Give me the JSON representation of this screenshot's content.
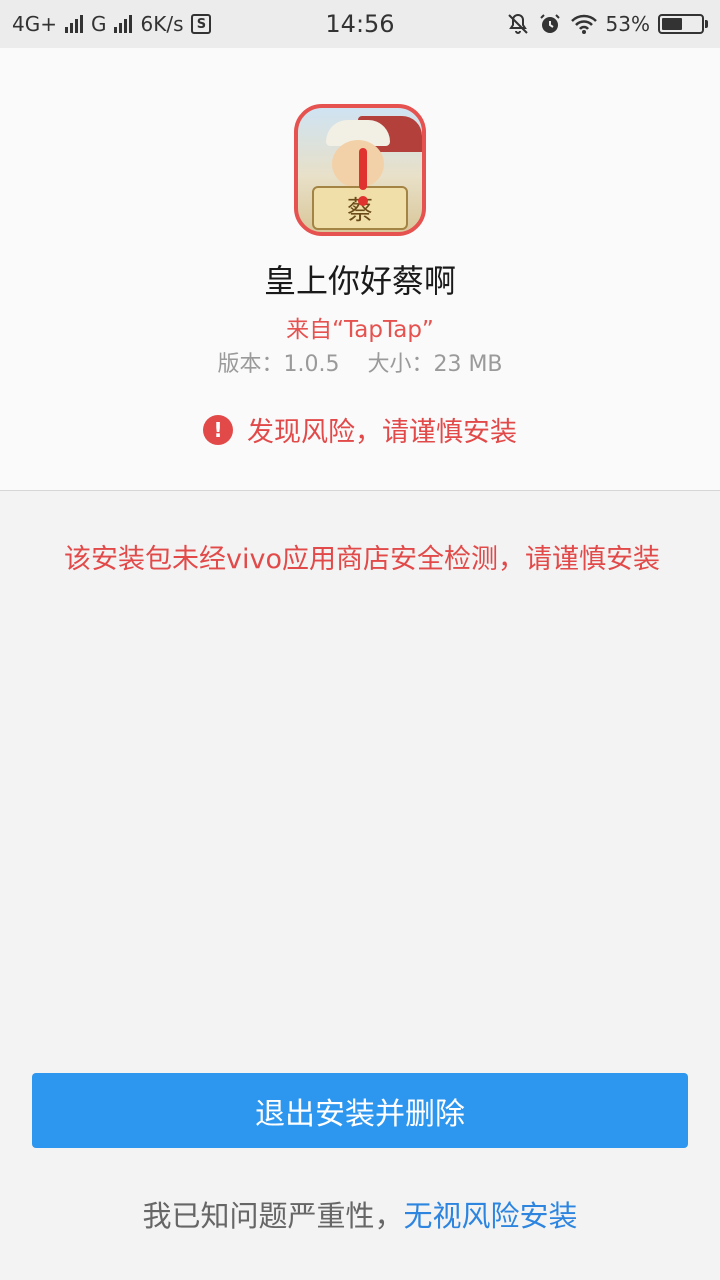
{
  "status_bar": {
    "network1": "4G+",
    "network2": "G",
    "speed": "6K/s",
    "s_badge": "S",
    "time": "14:56",
    "battery": "53%",
    "battery_level": 0.53,
    "icons": [
      "signal-icon",
      "signal-icon",
      "notification-muted-icon",
      "alarm-icon",
      "wifi-icon",
      "battery-icon"
    ]
  },
  "app": {
    "icon_char": "蔡",
    "name": "皇上你好蔡啊",
    "source": "来自“TapTap”",
    "version": "版本：1.0.5",
    "size": "大小：23 MB"
  },
  "risk": {
    "icon": "!",
    "text": "发现风险，请谨慎安装"
  },
  "warning": "该安装包未经vivo应用商店安全检测，请谨慎安装",
  "actions": {
    "exit_button": "退出安装并删除",
    "acknowledge_prefix": "我已知问题严重性，",
    "ignore_link": "无视风险安装"
  },
  "colors": {
    "accent_blue": "#2d97f0",
    "link_blue": "#2d85e0",
    "danger_red": "#e24a4a"
  }
}
